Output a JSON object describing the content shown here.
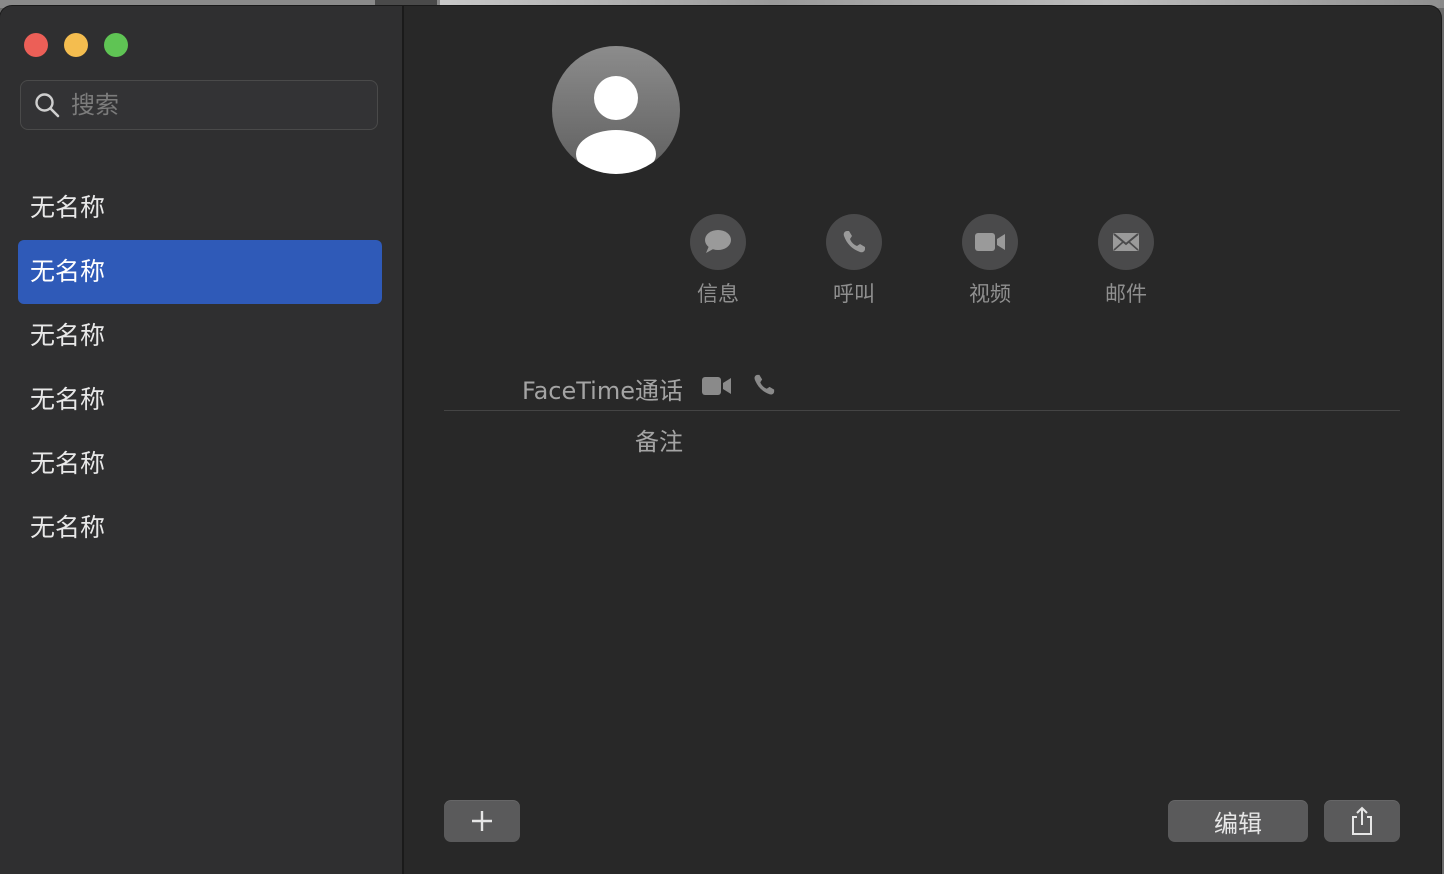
{
  "window": {
    "traffic_lights": [
      "close",
      "minimize",
      "maximize"
    ]
  },
  "search": {
    "placeholder": "搜索",
    "value": ""
  },
  "contacts": {
    "items": [
      {
        "label": "无名称",
        "selected": false
      },
      {
        "label": "无名称",
        "selected": true
      },
      {
        "label": "无名称",
        "selected": false
      },
      {
        "label": "无名称",
        "selected": false
      },
      {
        "label": "无名称",
        "selected": false
      },
      {
        "label": "无名称",
        "selected": false
      }
    ]
  },
  "detail": {
    "avatar_icon": "person-silhouette-icon",
    "actions": [
      {
        "label": "信息",
        "icon": "message-bubble-icon"
      },
      {
        "label": "呼叫",
        "icon": "phone-icon"
      },
      {
        "label": "视频",
        "icon": "video-camera-icon"
      },
      {
        "label": "邮件",
        "icon": "envelope-icon"
      }
    ],
    "facetime_label": "FaceTime通话",
    "notes_label": "备注"
  },
  "footer": {
    "add_label": "+",
    "edit_label": "编辑",
    "share_icon": "share-icon"
  },
  "colors": {
    "selection": "#2f5ab8",
    "sidebar_bg": "#2f2f30",
    "main_bg": "#282828"
  }
}
